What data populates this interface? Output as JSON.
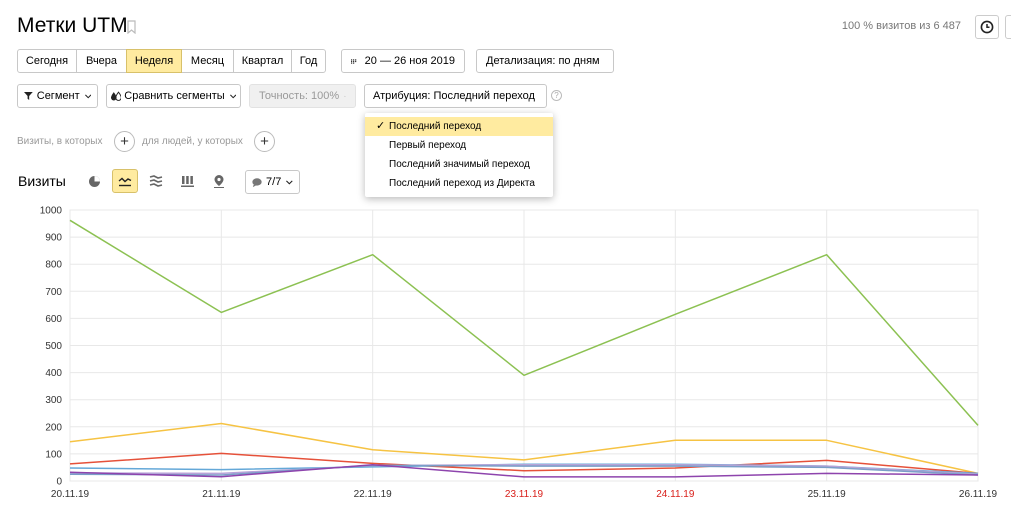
{
  "header": {
    "title": "Метки UTM",
    "visits_info": "100 % визитов из 6 487"
  },
  "periods": [
    {
      "label": "Сегодня",
      "active": false
    },
    {
      "label": "Вчера",
      "active": false
    },
    {
      "label": "Неделя",
      "active": true
    },
    {
      "label": "Месяц",
      "active": false
    },
    {
      "label": "Квартал",
      "active": false
    },
    {
      "label": "Год",
      "active": false
    }
  ],
  "date_range": "20 — 26 ноя 2019",
  "detail_label": "Детализация: по дням",
  "filters": {
    "segment_label": "Сегмент",
    "compare_label": "Сравнить сегменты",
    "accuracy_label": "Точность: 100%",
    "attribution_label": "Атрибуция: Последний переход",
    "info_glyph": "?"
  },
  "attribution_menu": {
    "check_mark": "✓",
    "items": [
      {
        "label": "Последний переход",
        "selected": true
      },
      {
        "label": "Первый переход",
        "selected": false
      },
      {
        "label": "Последний значимый переход",
        "selected": false
      },
      {
        "label": "Последний переход из Директа",
        "selected": false
      }
    ]
  },
  "segment_builder": {
    "visits_label": "Визиты, в которых",
    "people_label": "для людей, у которых",
    "plus": "+"
  },
  "chart_section": {
    "title": "Визиты",
    "series_count_label": "7/7"
  },
  "icons": [
    "bookmark-icon",
    "clock-icon",
    "calendar-icon",
    "filter-icon",
    "compare-icon",
    "pie-chart-icon",
    "line-chart-icon",
    "stacked-area-icon",
    "bar-chart-icon",
    "map-pin-icon",
    "comment-icon",
    "chevron-down-icon",
    "chevron-up-icon",
    "check-icon"
  ],
  "colors": {
    "accent_yellow": "#ffeba0",
    "weekend_red": "#d9201b",
    "grid": "#e8e8e8"
  },
  "chart_data": {
    "type": "line",
    "categories": [
      "20.11.19",
      "21.11.19",
      "22.11.19",
      "23.11.19",
      "24.11.19",
      "25.11.19",
      "26.11.19"
    ],
    "weekend_categories": [
      "23.11.19",
      "24.11.19"
    ],
    "ylim": [
      0,
      1000
    ],
    "yticks": [
      0,
      100,
      200,
      300,
      400,
      500,
      600,
      700,
      800,
      900,
      1000
    ],
    "grid": true,
    "series": [
      {
        "color": "#8cc152",
        "values": [
          962,
          622,
          835,
          390,
          615,
          835,
          205
        ]
      },
      {
        "color": "#f6c343",
        "values": [
          145,
          212,
          115,
          78,
          150,
          150,
          28
        ]
      },
      {
        "color": "#e5513a",
        "values": [
          63,
          102,
          65,
          38,
          48,
          76,
          28
        ]
      },
      {
        "color": "#64a8d8",
        "values": [
          48,
          42,
          52,
          62,
          62,
          55,
          28
        ]
      },
      {
        "color": "#b7a3d8",
        "values": [
          30,
          28,
          57,
          60,
          60,
          55,
          25
        ]
      },
      {
        "color": "#7a9ec8",
        "values": [
          25,
          22,
          58,
          55,
          55,
          50,
          22
        ]
      },
      {
        "color": "#8e44ad",
        "values": [
          32,
          16,
          60,
          15,
          15,
          28,
          22
        ]
      }
    ]
  }
}
